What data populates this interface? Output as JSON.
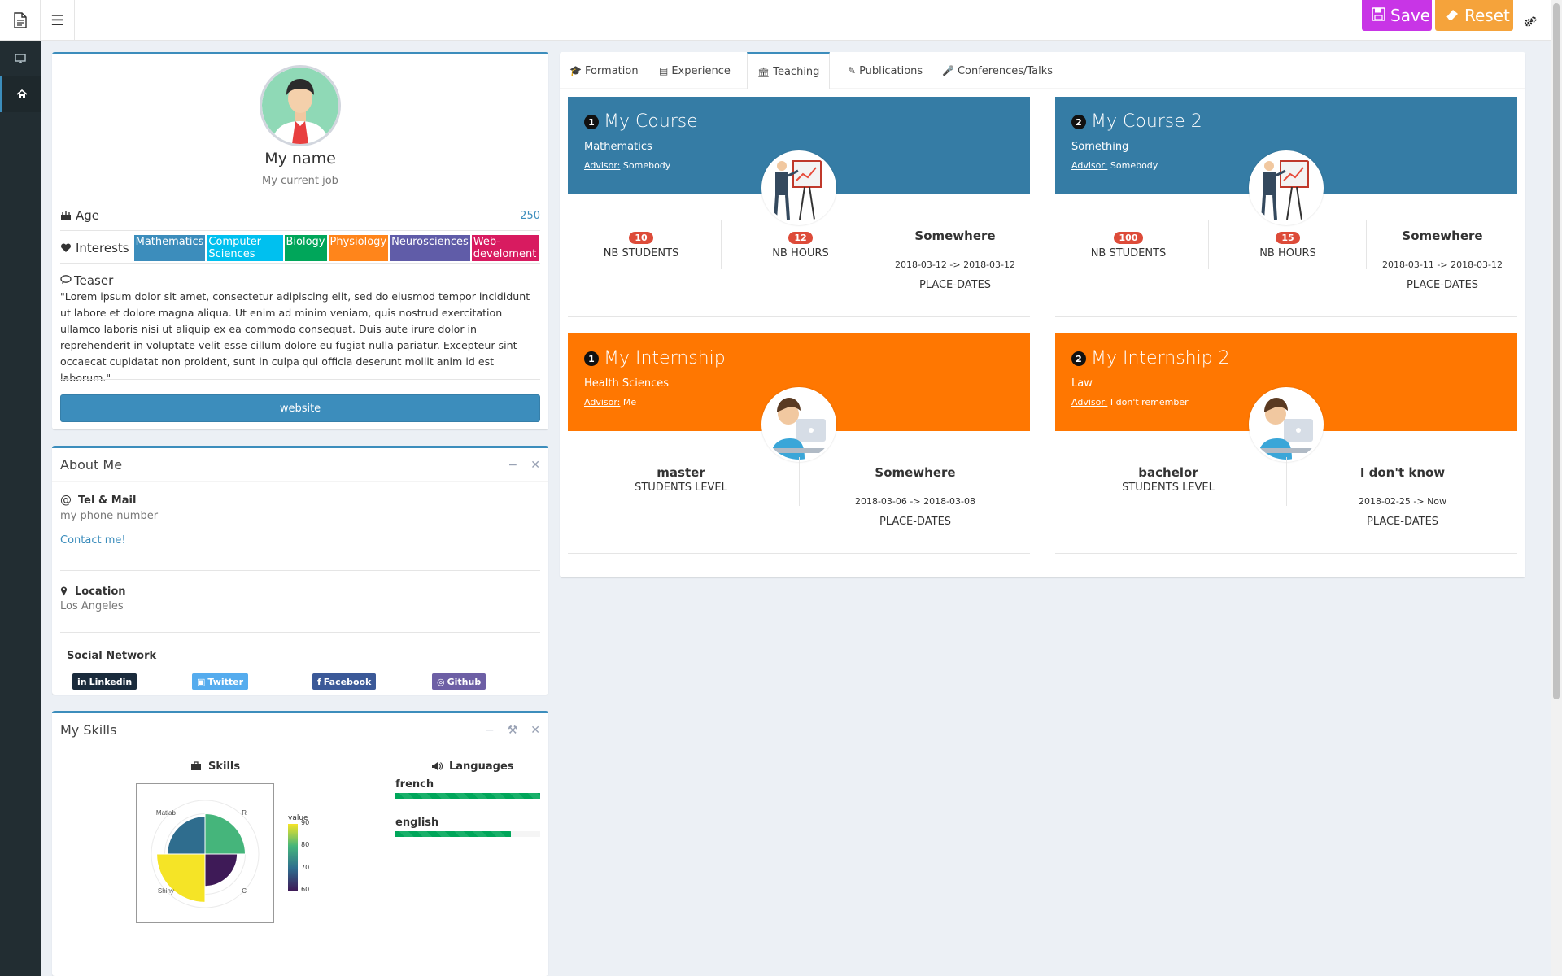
{
  "header": {
    "save_label": "Save",
    "reset_label": "Reset"
  },
  "profile": {
    "name": "My name",
    "job": "My current job",
    "age_label": "Age",
    "age_value": "250",
    "interests_label": "Interests",
    "interests": [
      {
        "label": "Mathematics",
        "color": "#3c8dbc"
      },
      {
        "label": "Computer Sciences",
        "color": "#00c0ef"
      },
      {
        "label": "Biology",
        "color": "#00a65a"
      },
      {
        "label": "Physiology",
        "color": "#ff851b"
      },
      {
        "label": "Neurosciences",
        "color": "#605ca8"
      },
      {
        "label": "Web-develoment",
        "color": "#d81b60"
      }
    ],
    "teaser_label": "Teaser",
    "teaser_text": "\"Lorem ipsum dolor sit amet, consectetur adipiscing elit, sed do eiusmod tempor incididunt ut labore et dolore magna aliqua. Ut enim ad minim veniam, quis nostrud exercitation ullamco laboris nisi ut aliquip ex ea commodo consequat. Duis aute irure dolor in reprehenderit in voluptate velit esse cillum dolore eu fugiat nulla pariatur. Excepteur sint occaecat cupidatat non proident, sunt in culpa qui officia deserunt mollit anim id est laborum.\"",
    "website_label": "website"
  },
  "about": {
    "title": "About Me",
    "tel_label": "Tel & Mail",
    "phone": "my phone number",
    "contact": "Contact me!",
    "location_label": "Location",
    "location": "Los Angeles",
    "social_label": "Social Network",
    "social": {
      "linkedin": "Linkedin",
      "twitter": "Twitter",
      "facebook": "Facebook",
      "github": "Github"
    }
  },
  "skills": {
    "title": "My Skills",
    "skills_label": "Skills",
    "languages_label": "Languages",
    "languages": [
      {
        "name": "french",
        "level": 1.0
      },
      {
        "name": "english",
        "level": 0.8
      }
    ],
    "chart_data": {
      "type": "bar",
      "coord": "polar",
      "categories": [
        "R",
        "C",
        "Shiny",
        "Matlab"
      ],
      "values": [
        75,
        60,
        90,
        70
      ],
      "yticks": [
        0,
        25,
        50,
        75
      ],
      "legend_title": "value",
      "legend_ticks": [
        60,
        70,
        80,
        90
      ],
      "colors": {
        "R": "#45b57b",
        "C": "#3e1a57",
        "Shiny": "#f5e426",
        "Matlab": "#2f6d8e"
      }
    }
  },
  "tabs": [
    {
      "label": "Formation",
      "icon": "graduation-cap-icon"
    },
    {
      "label": "Experience",
      "icon": "archive-icon"
    },
    {
      "label": "Teaching",
      "icon": "bank-icon"
    },
    {
      "label": "Publications",
      "icon": "pencil-icon"
    },
    {
      "label": "Conferences/Talks",
      "icon": "microphone-icon"
    }
  ],
  "courses": [
    {
      "num": "1",
      "title": "My Course",
      "subject": "Mathematics",
      "advisor_label": "Advisor:",
      "advisor": "Somebody",
      "students": "10",
      "students_label": "NB STUDENTS",
      "hours": "12",
      "hours_label": "NB HOURS",
      "place": "Somewhere",
      "dates": "2018-03-12 -> 2018-03-12",
      "pd_label": "PLACE-DATES",
      "color": "#357ca5"
    },
    {
      "num": "2",
      "title": "My Course 2",
      "subject": "Something",
      "advisor_label": "Advisor:",
      "advisor": "Somebody",
      "students": "100",
      "students_label": "NB STUDENTS",
      "hours": "15",
      "hours_label": "NB HOURS",
      "place": "Somewhere",
      "dates": "2018-03-11 -> 2018-03-12",
      "pd_label": "PLACE-DATES",
      "color": "#357ca5"
    }
  ],
  "internships": [
    {
      "num": "1",
      "title": "My Internship",
      "subject": "Health Sciences",
      "advisor_label": "Advisor:",
      "advisor": "Me",
      "level": "master",
      "level_label": "STUDENTS LEVEL",
      "place": "Somewhere",
      "dates": "2018-03-06 -> 2018-03-08",
      "pd_label": "PLACE-DATES",
      "color": "#ff7701"
    },
    {
      "num": "2",
      "title": "My Internship 2",
      "subject": "Law",
      "advisor_label": "Advisor:",
      "advisor": "I don't remember",
      "level": "bachelor",
      "level_label": "STUDENTS LEVEL",
      "place": "I don't know",
      "dates": "2018-02-25 -> Now",
      "pd_label": "PLACE-DATES",
      "color": "#ff7701"
    }
  ]
}
